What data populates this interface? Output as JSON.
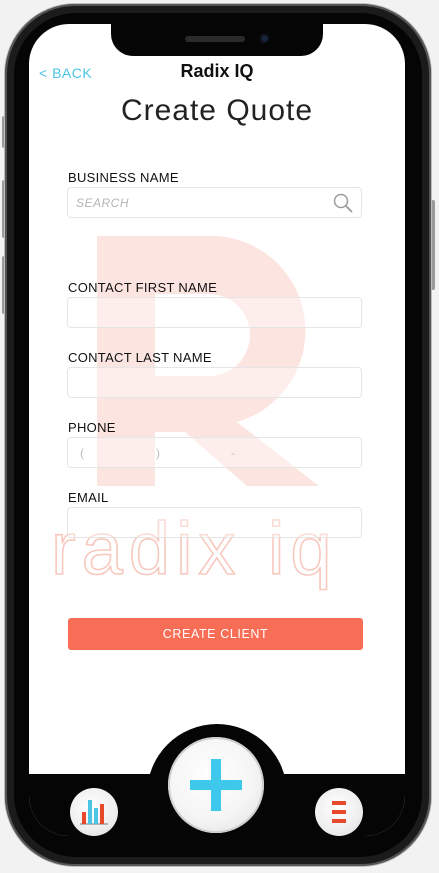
{
  "header": {
    "back_label": "< BACK",
    "app_title": "Radix IQ"
  },
  "page": {
    "title": "Create Quote"
  },
  "watermark": {
    "word": "radix iq"
  },
  "form": {
    "business_name": {
      "label": "BUSINESS NAME",
      "placeholder": "SEARCH"
    },
    "contact_first": {
      "label": "CONTACT FIRST NAME",
      "value": ""
    },
    "contact_last": {
      "label": "CONTACT LAST NAME",
      "value": ""
    },
    "phone": {
      "label": "PHONE",
      "open_paren": "(",
      "close_paren": ")",
      "dash": "-"
    },
    "email": {
      "label": "EMAIL",
      "value": ""
    },
    "submit_label": "CREATE CLIENT"
  },
  "bottom_nav": {
    "left_icon": "bar-chart-icon",
    "center_icon": "plus-icon",
    "right_icon": "menu-icon"
  },
  "colors": {
    "accent": "#4bc5e6",
    "primary_button": "#f76d55",
    "watermark": "#f7c9bf"
  }
}
